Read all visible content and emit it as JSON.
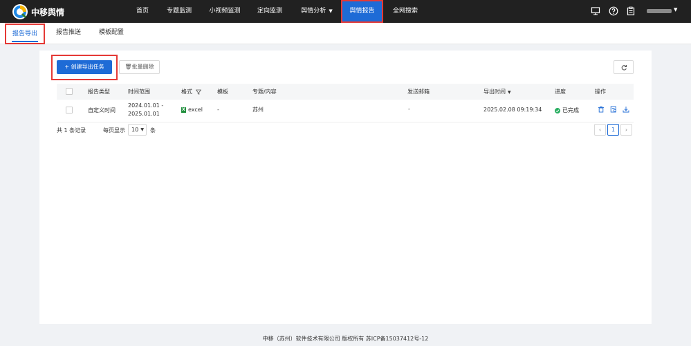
{
  "app": {
    "title": "中移舆情"
  },
  "nav": {
    "items": [
      {
        "label": "首页"
      },
      {
        "label": "专题监测"
      },
      {
        "label": "小视频监测"
      },
      {
        "label": "定向监测"
      },
      {
        "label": "舆情分析"
      },
      {
        "label": "舆情报告"
      },
      {
        "label": "全网搜索"
      }
    ],
    "active_index": 5
  },
  "top_icons": [
    "monitor-icon",
    "help-icon",
    "clipboard-icon"
  ],
  "subnav": {
    "tabs": [
      {
        "label": "报告导出"
      },
      {
        "label": "报告推送"
      },
      {
        "label": "模板配置"
      }
    ],
    "active_index": 0
  },
  "toolbar": {
    "create_label": "+ 创建导出任务",
    "delete_label": "批量删除",
    "refresh_icon": "refresh-icon"
  },
  "table": {
    "columns": [
      "报告类型",
      "时间范围",
      "格式",
      "模板",
      "专题/内容",
      "发送邮箱",
      "导出时间",
      "进度",
      "操作"
    ],
    "rows": [
      {
        "type": "自定义时间",
        "range_start": "2024.01.01 -",
        "range_end": "2025.01.01",
        "format": "excel",
        "template": "-",
        "topic": "苏州",
        "email": "-",
        "export_time": "2025.02.08 09:19:34",
        "progress": "已完成"
      }
    ]
  },
  "pagination": {
    "total_text": "共 1 条记录",
    "per_page_label": "每页显示",
    "page_size": "10",
    "unit": "条",
    "current_page": "1",
    "prev": "‹",
    "next": "›"
  },
  "footer": {
    "text": "中移（苏州）软件技术有限公司 版权所有 苏ICP备15037412号-12"
  },
  "colors": {
    "primary": "#1e6bd6",
    "highlight": "#e53935",
    "success": "#27ae60",
    "topbar": "#212121"
  }
}
